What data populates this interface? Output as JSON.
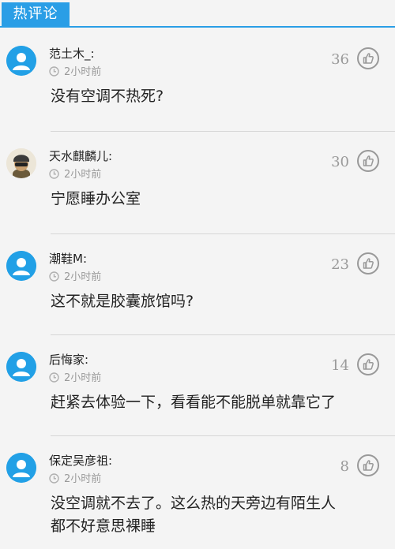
{
  "header": {
    "title": "热评论"
  },
  "comments": [
    {
      "user": "范土木_:",
      "time": "2小时前",
      "likes": "36",
      "text": [
        "没有空调不热死?"
      ],
      "avatar": "default"
    },
    {
      "user": "天水麒麟儿:",
      "time": "2小时前",
      "likes": "30",
      "text": [
        "宁愿睡办公室"
      ],
      "avatar": "photo"
    },
    {
      "user": "潮鞋M:",
      "time": "2小时前",
      "likes": "23",
      "text": [
        "这不就是胶囊旅馆吗?"
      ],
      "avatar": "default"
    },
    {
      "user": "后悔家:",
      "time": "2小时前",
      "likes": "14",
      "text": [
        "赶紧去体验一下，看看能不能脱单就靠它了"
      ],
      "avatar": "default"
    },
    {
      "user": "保定吴彦祖:",
      "time": "2小时前",
      "likes": "8",
      "text": [
        "没空调就不去了。这么热的天旁边有陌生人",
        "都不好意思裸睡"
      ],
      "avatar": "default"
    }
  ],
  "colors": {
    "accent": "#2a9ee6",
    "avatar": "#22a0e6",
    "meta": "#9a9a9a"
  },
  "icons": {
    "like": "thumbs-up-icon",
    "time": "clock-icon",
    "avatar": "user-avatar-icon"
  }
}
